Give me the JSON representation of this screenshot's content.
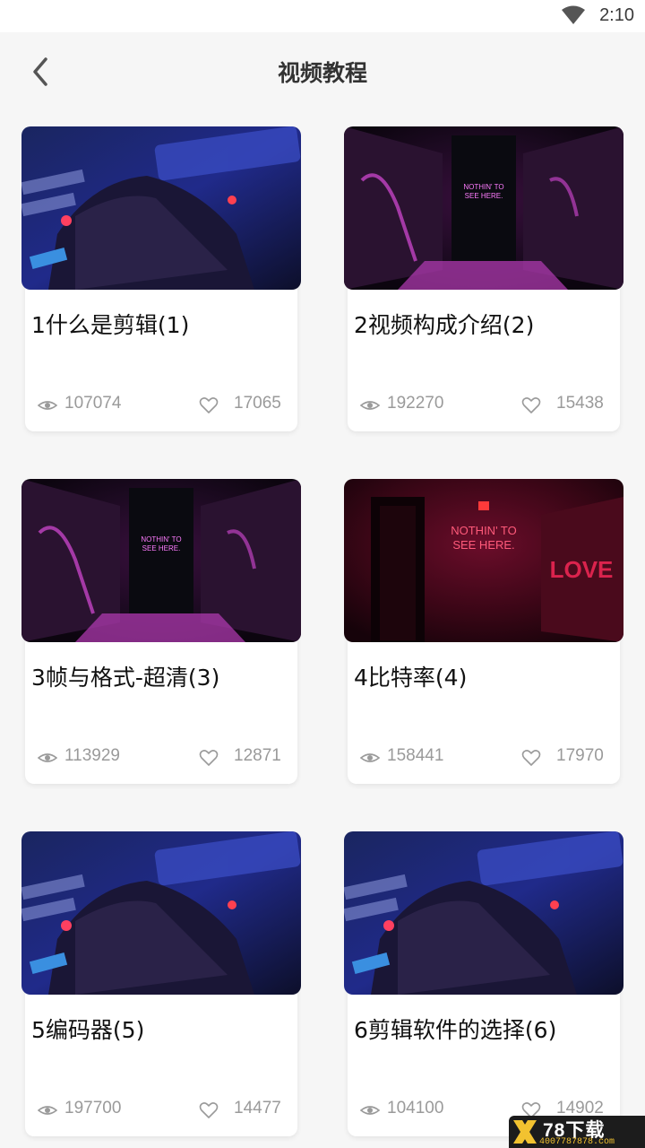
{
  "status_bar": {
    "time": "2:10",
    "wifi_icon": "wifi-icon"
  },
  "header": {
    "title": "视频教程",
    "back_icon": "chevron-left-icon"
  },
  "videos": [
    {
      "title": "1什么是剪辑(1)",
      "views": "107074",
      "likes": "17065",
      "thumb": "keyboard"
    },
    {
      "title": "2视频构成介绍(2)",
      "views": "192270",
      "likes": "15438",
      "thumb": "neon-purple"
    },
    {
      "title": "3帧与格式-超清(3)",
      "views": "113929",
      "likes": "12871",
      "thumb": "neon-purple"
    },
    {
      "title": "4比特率(4)",
      "views": "158441",
      "likes": "17970",
      "thumb": "neon-red"
    },
    {
      "title": "5编码器(5)",
      "views": "197700",
      "likes": "14477",
      "thumb": "keyboard"
    },
    {
      "title": "6剪辑软件的选择(6)",
      "views": "104100",
      "likes": "14902",
      "thumb": "keyboard"
    }
  ],
  "watermark": {
    "brand": "78下载",
    "phone": "4007787878.com"
  },
  "colors": {
    "background": "#f6f6f6",
    "card": "#ffffff",
    "stat_text": "#9a9a9a",
    "title_text": "#333333"
  }
}
